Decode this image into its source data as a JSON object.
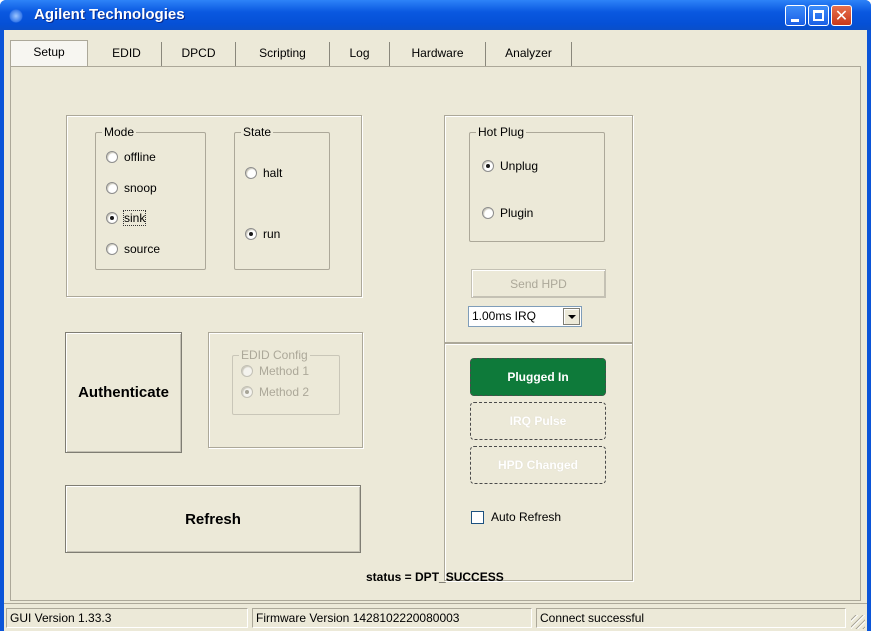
{
  "window": {
    "title": "Agilent Technologies",
    "controls": {
      "minimize": "minimize",
      "maximize": "maximize",
      "close": "✕"
    }
  },
  "tabs": [
    {
      "label": "Setup",
      "active": true
    },
    {
      "label": "EDID",
      "active": false
    },
    {
      "label": "DPCD",
      "active": false
    },
    {
      "label": "Scripting",
      "active": false
    },
    {
      "label": "Log",
      "active": false
    },
    {
      "label": "Hardware",
      "active": false
    },
    {
      "label": "Analyzer",
      "active": false
    }
  ],
  "mode": {
    "label": "Mode",
    "options": [
      "offline",
      "snoop",
      "sink",
      "source"
    ],
    "selected": "sink"
  },
  "state": {
    "label": "State",
    "options": [
      "halt",
      "run"
    ],
    "selected": "run"
  },
  "hot_plug": {
    "label": "Hot Plug",
    "options": [
      "Unplug",
      "Plugin"
    ],
    "selected": "Unplug"
  },
  "edid_config": {
    "label": "EDID Config",
    "options": [
      "Method 1",
      "Method 2"
    ],
    "selected": "Method 2",
    "enabled": false
  },
  "buttons": {
    "authenticate": "Authenticate",
    "refresh": "Refresh",
    "send_hpd": "Send HPD"
  },
  "irq_select": {
    "value": "1.00ms IRQ"
  },
  "indicators": {
    "plugged_in": "Plugged In",
    "irq_pulse": "IRQ Pulse",
    "hpd_changed": "HPD Changed"
  },
  "auto_refresh": {
    "label": "Auto Refresh",
    "checked": false
  },
  "status_line": "status = DPT_SUCCESS",
  "statusbar": {
    "gui_version": "GUI Version 1.33.3",
    "firmware_version": "Firmware Version 1428102220080003",
    "connection": "Connect successful"
  },
  "colors": {
    "titlebar": "#0a58e0",
    "client_bg": "#ece9d8",
    "plugged_in_bg": "#0e7a3a"
  }
}
